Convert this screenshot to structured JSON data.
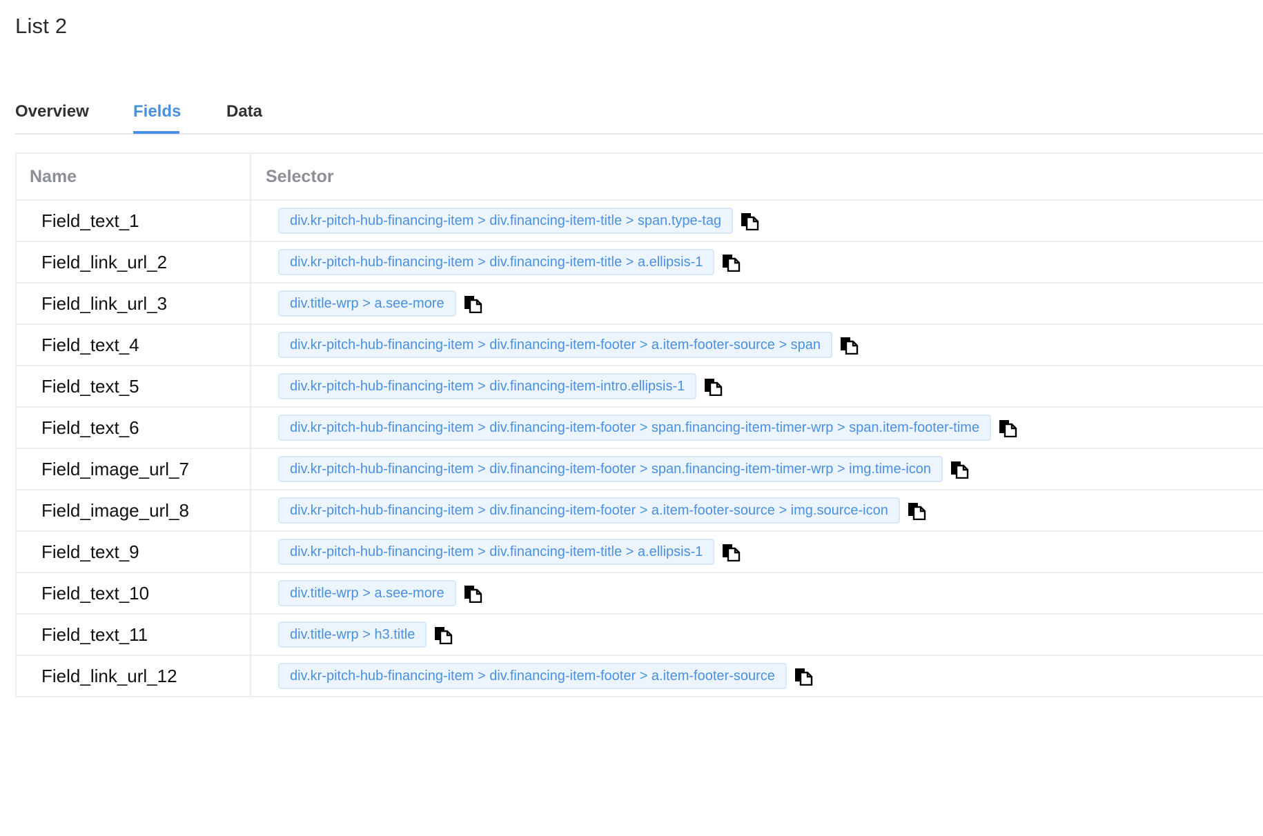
{
  "page": {
    "title": "List 2"
  },
  "tabs": [
    {
      "label": "Overview",
      "active": false
    },
    {
      "label": "Fields",
      "active": true
    },
    {
      "label": "Data",
      "active": false
    }
  ],
  "table": {
    "headers": {
      "name": "Name",
      "selector": "Selector"
    },
    "rows": [
      {
        "name": "Field_text_1",
        "selector": "div.kr-pitch-hub-financing-item > div.financing-item-title > span.type-tag"
      },
      {
        "name": "Field_link_url_2",
        "selector": "div.kr-pitch-hub-financing-item > div.financing-item-title > a.ellipsis-1"
      },
      {
        "name": "Field_link_url_3",
        "selector": "div.title-wrp > a.see-more"
      },
      {
        "name": "Field_text_4",
        "selector": "div.kr-pitch-hub-financing-item > div.financing-item-footer > a.item-footer-source > span"
      },
      {
        "name": "Field_text_5",
        "selector": "div.kr-pitch-hub-financing-item > div.financing-item-intro.ellipsis-1"
      },
      {
        "name": "Field_text_6",
        "selector": "div.kr-pitch-hub-financing-item > div.financing-item-footer > span.financing-item-timer-wrp > span.item-footer-time"
      },
      {
        "name": "Field_image_url_7",
        "selector": "div.kr-pitch-hub-financing-item > div.financing-item-footer > span.financing-item-timer-wrp > img.time-icon"
      },
      {
        "name": "Field_image_url_8",
        "selector": "div.kr-pitch-hub-financing-item > div.financing-item-footer > a.item-footer-source > img.source-icon"
      },
      {
        "name": "Field_text_9",
        "selector": "div.kr-pitch-hub-financing-item > div.financing-item-title > a.ellipsis-1"
      },
      {
        "name": "Field_text_10",
        "selector": "div.title-wrp > a.see-more"
      },
      {
        "name": "Field_text_11",
        "selector": "div.title-wrp > h3.title"
      },
      {
        "name": "Field_link_url_12",
        "selector": "div.kr-pitch-hub-financing-item > div.financing-item-footer > a.item-footer-source"
      }
    ]
  },
  "icons": {
    "copy": "copy-icon"
  },
  "colors": {
    "accent": "#4a90e2",
    "tag_bg": "#ecf4fd",
    "tag_border": "#d9e9fb",
    "header_text": "#8c8f96",
    "border": "#ebeef5"
  }
}
